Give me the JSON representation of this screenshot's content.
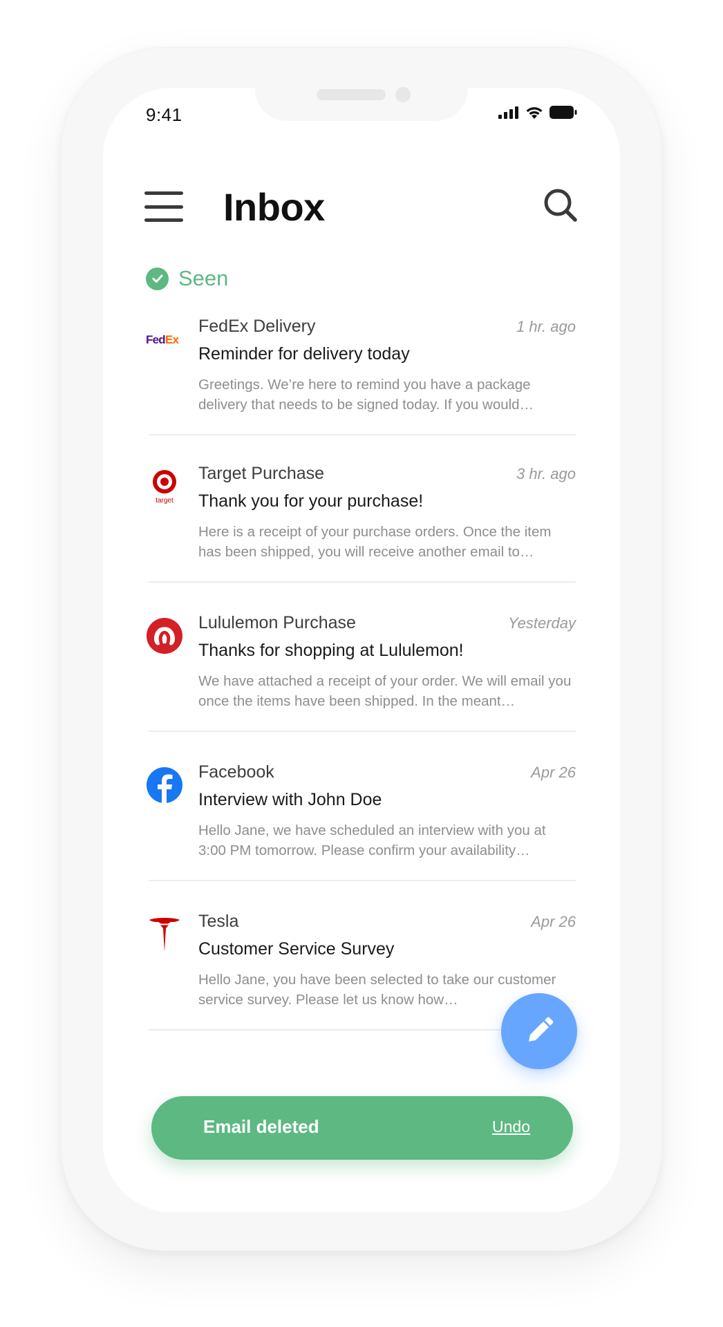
{
  "status_bar": {
    "time": "9:41"
  },
  "header": {
    "title": "Inbox"
  },
  "section": {
    "label": "Seen"
  },
  "emails": [
    {
      "logo": "fedex-logo",
      "sender": "FedEx Delivery",
      "time": "1 hr. ago",
      "subject": "Reminder for delivery today",
      "preview": "Greetings. We’re here to remind you have a package delivery that needs to be signed today. If you would…"
    },
    {
      "logo": "target-logo",
      "logo_text": "target",
      "sender": "Target Purchase",
      "time": "3 hr. ago",
      "subject": "Thank you for your purchase!",
      "preview": "Here is a receipt of your purchase orders. Once the item has been shipped, you will receive another email to…"
    },
    {
      "logo": "lululemon-logo",
      "sender": "Lululemon Purchase",
      "time": "Yesterday",
      "subject": "Thanks for shopping at Lululemon!",
      "preview": "We have attached a receipt of your order. We will email you once the items have been shipped. In the meant…"
    },
    {
      "logo": "facebook-logo",
      "sender": "Facebook",
      "time": "Apr 26",
      "subject": "Interview with John Doe",
      "preview": "Hello Jane, we have scheduled an interview with you at 3:00 PM tomorrow. Please confirm your availability…"
    },
    {
      "logo": "tesla-logo",
      "sender": "Tesla",
      "time": "Apr 26",
      "subject": "Customer Service Survey",
      "preview": "Hello Jane, you have been selected to take our customer service survey. Please let us know how…"
    }
  ],
  "fab": {
    "icon": "pencil-icon"
  },
  "snackbar": {
    "message": "Email deleted",
    "action": "Undo"
  },
  "colors": {
    "accent_green": "#5eb882",
    "fab_blue": "#66a6ff",
    "fedex_purple": "#4d148c",
    "fedex_orange": "#ff6600",
    "target_red": "#cc0000",
    "lululemon_red": "#d31f26",
    "facebook_blue": "#1877f2",
    "tesla_red": "#cc0000"
  }
}
